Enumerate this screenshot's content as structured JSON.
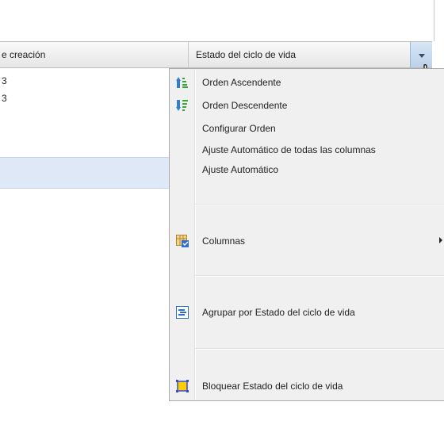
{
  "grid": {
    "columns": [
      {
        "label": "e creación"
      },
      {
        "label": "Estado del ciclo de vida"
      }
    ],
    "rows": [
      {
        "value": "3"
      },
      {
        "value": "3"
      }
    ]
  },
  "menu": {
    "items": [
      {
        "label": "Orden Ascendente",
        "icon": "sort-ascending-icon"
      },
      {
        "label": "Orden Descendente",
        "icon": "sort-descending-icon"
      },
      {
        "label": "Configurar Orden",
        "icon": ""
      },
      {
        "label": "Ajuste Automático de todas las columnas",
        "icon": ""
      },
      {
        "label": "Ajuste Automático",
        "icon": ""
      },
      {
        "label": "Columnas",
        "icon": "columns-icon",
        "submenu": true
      },
      {
        "label": "Agrupar por Estado del ciclo de vida",
        "icon": "group-by-icon"
      },
      {
        "label": "Bloquear Estado del ciclo de vida",
        "icon": "lock-column-icon"
      }
    ]
  },
  "colors": {
    "menu_bg": "#f0f0f0",
    "header_trigger": "#c6daf0",
    "selected_row": "#dfe8f6"
  }
}
